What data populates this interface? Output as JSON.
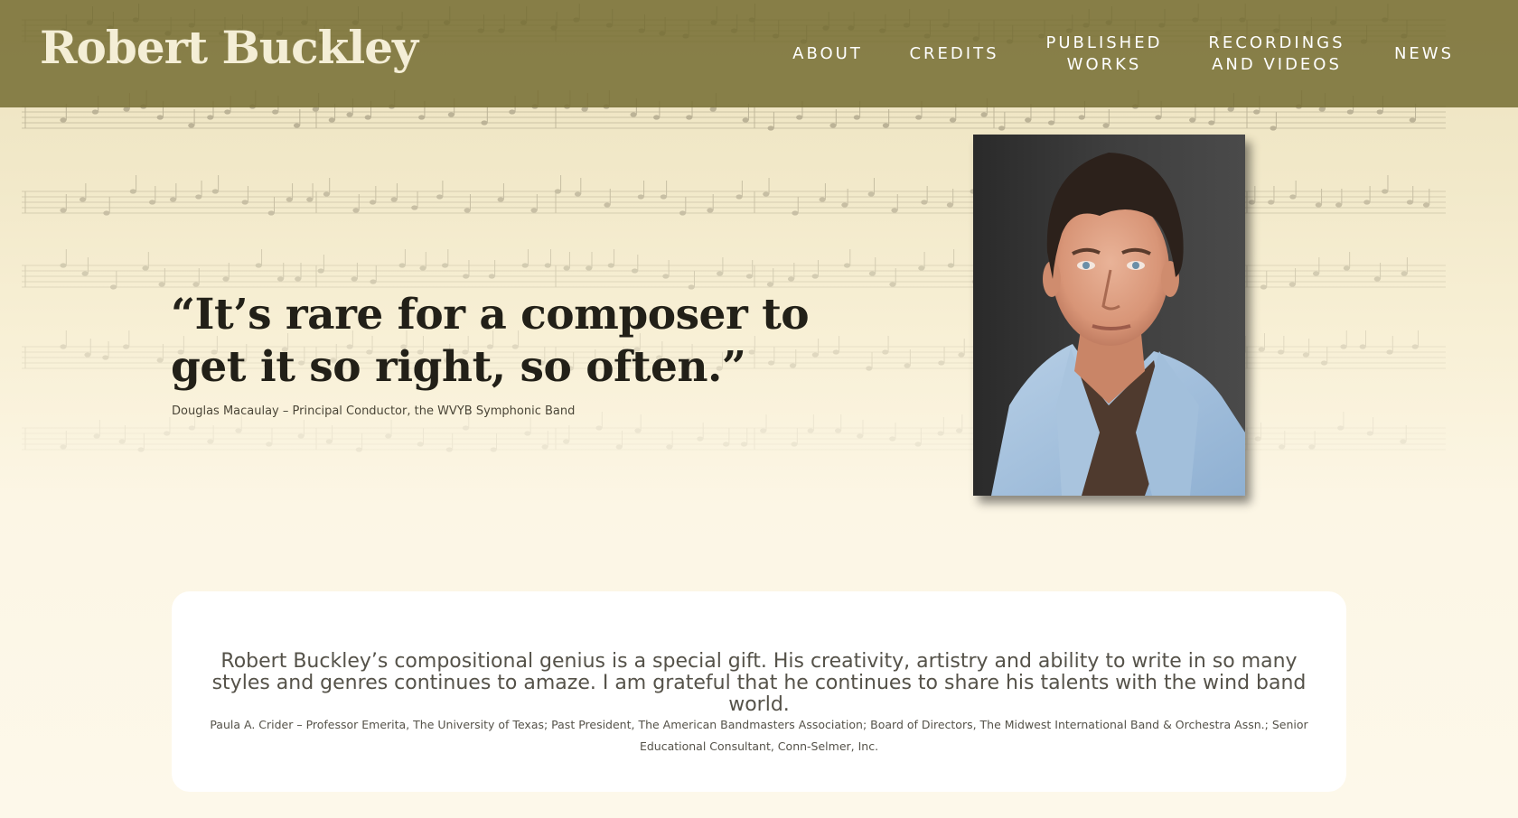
{
  "header": {
    "site_title": "Robert Buckley",
    "nav": [
      {
        "label": "ABOUT"
      },
      {
        "label": "CREDITS"
      },
      {
        "label": "PUBLISHED WORKS"
      },
      {
        "label": "RECORDINGS AND VIDEOS"
      },
      {
        "label": "NEWS"
      }
    ]
  },
  "hero": {
    "quote": "“It’s rare for a composer to get it so right, so often.”",
    "attribution": "Douglas Macaulay – Principal Conductor, the WVYB Symphonic Band",
    "portrait_alt": "Portrait of Robert Buckley"
  },
  "testimonial": {
    "quote": "Robert Buckley’s compositional genius is a special gift. His creativity, artistry and ability to write in so many styles and genres continues to amaze. I am grateful that he continues to share his talents with the wind band world.",
    "attribution": "Paula A. Crider – Professor Emerita, The University of Texas; Past President, The American Bandmasters Association; Board of Directors, The Midwest International Band & Orchestra Assn.; Senior Educational Consultant, Conn-Selmer, Inc."
  },
  "colors": {
    "header_bg": "#766e33",
    "page_bg": "#fcf7e7",
    "card_bg": "#ffffff",
    "title_text": "#f4eed6"
  }
}
